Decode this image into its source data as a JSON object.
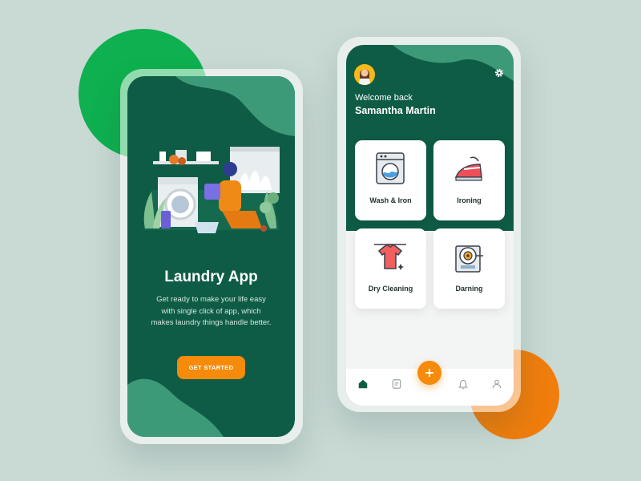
{
  "colors": {
    "primary_green": "#0f5c46",
    "accent_green": "#3d9a78",
    "accent_orange": "#f58a0b",
    "background": "#c9d9d4"
  },
  "onboarding": {
    "title": "Laundry App",
    "description": "Get ready to make your life easy with single click of app, which makes laundry things handle better.",
    "cta_label": "GET STARTED"
  },
  "home": {
    "welcome": "Welcome back",
    "user_name": "Samantha Martin",
    "services": [
      {
        "label": "Wash & Iron",
        "icon": "washing-machine-icon"
      },
      {
        "label": "Ironing",
        "icon": "iron-icon"
      },
      {
        "label": "Dry Cleaning",
        "icon": "shirt-hanger-icon"
      },
      {
        "label": "Darning",
        "icon": "sewing-machine-icon"
      }
    ],
    "nav": [
      "home-icon",
      "orders-icon",
      "add-icon",
      "bell-icon",
      "profile-icon"
    ]
  }
}
